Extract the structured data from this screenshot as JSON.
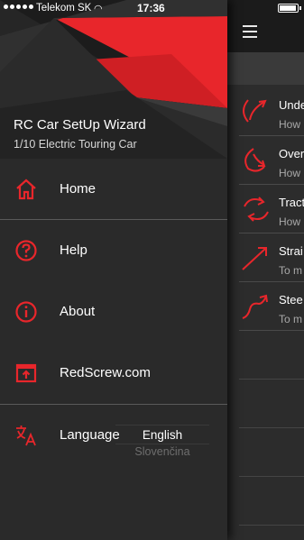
{
  "status_bar": {
    "carrier": "Telekom SK",
    "time": "17:36"
  },
  "drawer": {
    "app_title": "RC Car SetUp Wizard",
    "app_subtitle": "1/10 Electric Touring Car",
    "menu": [
      {
        "label": "Home",
        "icon": "home-icon"
      },
      {
        "label": "Help",
        "icon": "help-circle-icon"
      },
      {
        "label": "About",
        "icon": "info-icon"
      },
      {
        "label": "RedScrew.com",
        "icon": "open-external-icon"
      },
      {
        "label": "Language",
        "icon": "translate-icon"
      }
    ],
    "language_picker": {
      "selected": "English",
      "next_option": "Slovenčina"
    }
  },
  "main": {
    "rows": [
      {
        "title": "Unde",
        "subtitle": "How",
        "icon": "understeer-arrow-icon"
      },
      {
        "title": "Over",
        "subtitle": "How",
        "icon": "oversteer-arrow-icon"
      },
      {
        "title": "Tract",
        "subtitle": "How",
        "icon": "traction-cycle-icon"
      },
      {
        "title": "Strai",
        "subtitle": "To m",
        "icon": "straight-arrow-icon"
      },
      {
        "title": "Stee",
        "subtitle": "To m",
        "icon": "steering-zigzag-icon"
      }
    ]
  },
  "colors": {
    "accent": "#e8262b",
    "drawer_bg": "#2a2a2a",
    "divider": "#5a5a5a"
  }
}
